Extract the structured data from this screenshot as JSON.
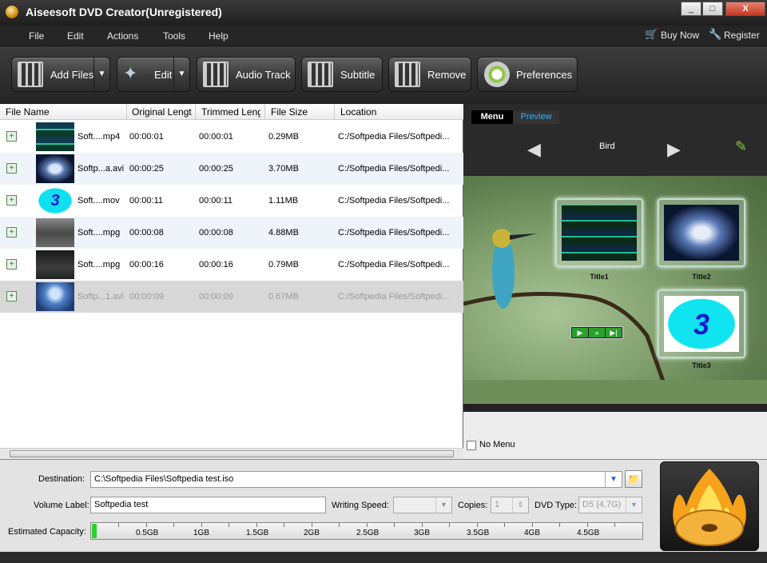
{
  "window": {
    "title": "Aiseesoft DVD Creator(Unregistered)",
    "minimize": "_",
    "maximize": "□",
    "close": "X"
  },
  "menubar": {
    "items": [
      "File",
      "Edit",
      "Actions",
      "Tools",
      "Help"
    ],
    "buy_now": "Buy Now",
    "register": "Register"
  },
  "toolbar": {
    "add_files": "Add Files",
    "edit": "Edit",
    "audio_track": "Audio Track",
    "subtitle": "Subtitle",
    "remove": "Remove",
    "preferences": "Preferences"
  },
  "filelist": {
    "columns": [
      "File Name",
      "Original Lengt",
      "Trimmed Leng",
      "File Size",
      "Location"
    ],
    "rows": [
      {
        "name": "Soft....mp4",
        "original": "00:00:01",
        "trimmed": "00:00:01",
        "size": "0.29MB",
        "location": "C:/Softpedia Files/Softpedi..."
      },
      {
        "name": "Softp...a.avi",
        "original": "00:00:25",
        "trimmed": "00:00:25",
        "size": "3.70MB",
        "location": "C:/Softpedia Files/Softpedi..."
      },
      {
        "name": "Soft....mov",
        "original": "00:00:11",
        "trimmed": "00:00:11",
        "size": "1.11MB",
        "location": "C:/Softpedia Files/Softpedi..."
      },
      {
        "name": "Soft....mpg",
        "original": "00:00:08",
        "trimmed": "00:00:08",
        "size": "4.88MB",
        "location": "C:/Softpedia Files/Softpedi..."
      },
      {
        "name": "Soft....mpg",
        "original": "00:00:16",
        "trimmed": "00:00:16",
        "size": "0.79MB",
        "location": "C:/Softpedia Files/Softpedi..."
      },
      {
        "name": "Softp...1.avi",
        "original": "00:00:09",
        "trimmed": "00:00:09",
        "size": "0.67MB",
        "location": "C:/Softpedia Files/Softpedi..."
      }
    ]
  },
  "preview": {
    "tab_menu": "Menu",
    "tab_preview": "Preview",
    "template": "Bird",
    "titles": [
      "Title1",
      "Title2",
      "Title3"
    ],
    "thumb3_text": "3",
    "no_menu": "No Menu"
  },
  "bottom": {
    "destination_label": "Destination:",
    "destination_value": "C:\\Softpedia Files\\Softpedia test.iso",
    "volume_label": "Volume Label:",
    "volume_value": "Softpedia test",
    "speed_label": "Writing Speed:",
    "copies_label": "Copies:",
    "copies_value": "1",
    "dvdtype_label": "DVD Type:",
    "dvdtype_value": "D5 (4.7G)",
    "capacity_label": "Estimated Capacity:",
    "capacity_marks": [
      "0.5GB",
      "1GB",
      "1.5GB",
      "2GB",
      "2.5GB",
      "3GB",
      "3.5GB",
      "4GB",
      "4.5GB"
    ]
  }
}
